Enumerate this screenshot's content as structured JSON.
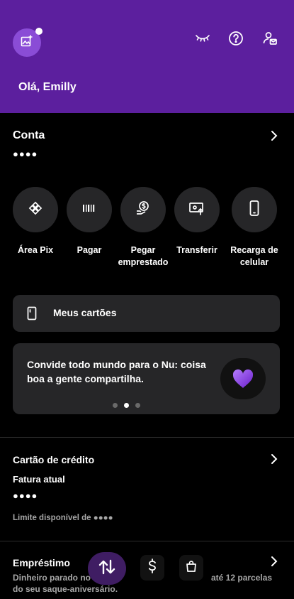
{
  "header": {
    "greeting": "Olá, Emilly",
    "icons": [
      "add-photo-icon",
      "hide-values-icon",
      "help-icon",
      "profile-invite-icon"
    ]
  },
  "account": {
    "title": "Conta",
    "balance": "●●●●"
  },
  "actions": [
    {
      "label": "Área Pix",
      "icon": "pix-icon"
    },
    {
      "label": "Pagar",
      "icon": "barcode-icon"
    },
    {
      "label": "Pegar emprestado",
      "icon": "loan-icon"
    },
    {
      "label": "Transferir",
      "icon": "transfer-icon"
    },
    {
      "label": "Recarga de celular",
      "icon": "phone-icon"
    }
  ],
  "cards": {
    "label": "Meus cartões"
  },
  "promo": {
    "text": "Convide todo mundo para o Nu: coisa boa a gente compartilha.",
    "icon": "purple-heart-icon",
    "pages": 3,
    "active_page": 2
  },
  "credit": {
    "title": "Cartão de crédito",
    "invoice_label": "Fatura atual",
    "invoice_value": "●●●●",
    "limit_text": "Limite disponível de ●●●●"
  },
  "loan": {
    "title": "Empréstimo",
    "desc_left": "Dinheiro parado no",
    "desc_right": "até 12 parcelas",
    "desc_line2": "do seu saque-aniversário."
  },
  "colors": {
    "brand": "#5c1f9e",
    "card_bg": "#262628",
    "background": "#000000"
  }
}
